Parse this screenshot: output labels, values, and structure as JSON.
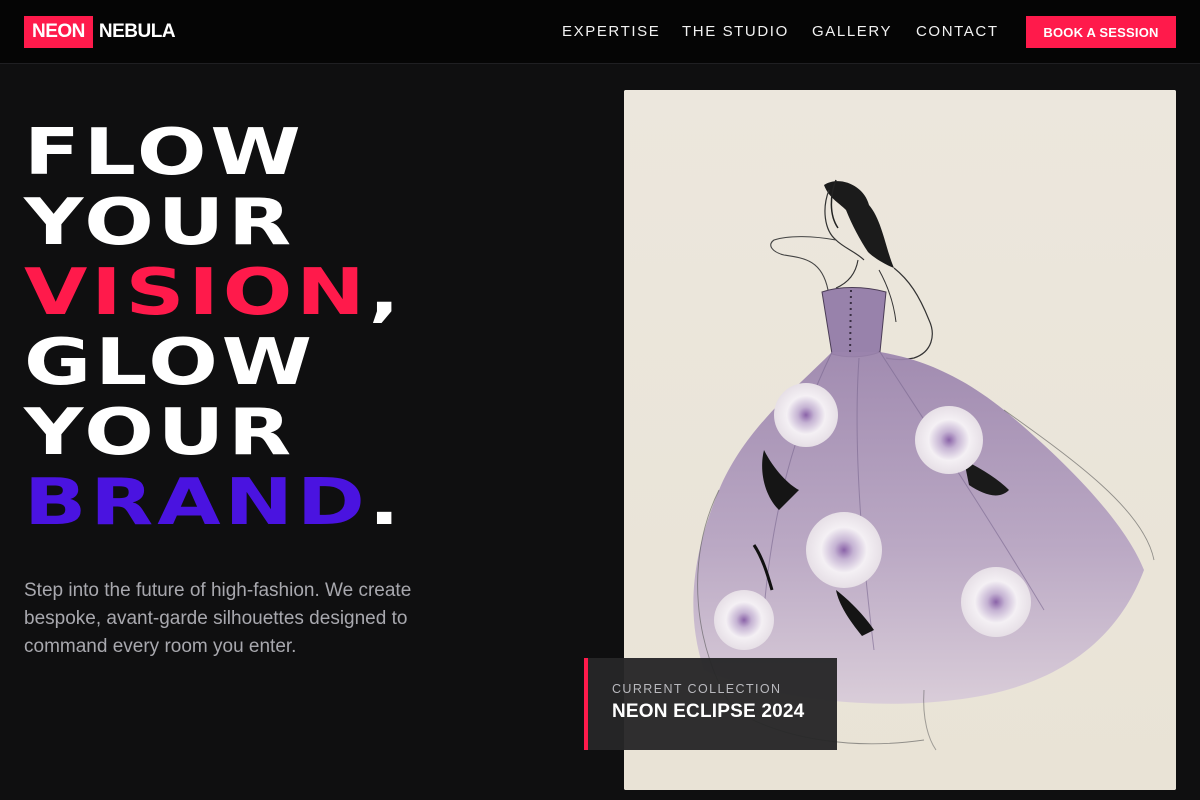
{
  "brand": {
    "part1": "NEON",
    "part2": "NEBULA"
  },
  "nav": {
    "items": [
      {
        "label": "EXPERTISE"
      },
      {
        "label": "THE STUDIO"
      },
      {
        "label": "GALLERY"
      },
      {
        "label": "CONTACT"
      }
    ],
    "cta": "BOOK A SESSION"
  },
  "hero": {
    "line1": "FLOW",
    "line2": "YOUR",
    "line3_accent": "VISION",
    "line3_punct": ",",
    "line4": "GLOW",
    "line5": "YOUR",
    "line6_accent": "BRAND",
    "line6_punct": ".",
    "subtitle": "Step into the future of high-fashion. We create bespoke, avant-garde silhouettes designed to command every room you enter."
  },
  "collection": {
    "label": "CURRENT COLLECTION",
    "name": "NEON ECLIPSE 2024"
  },
  "colors": {
    "accent_pink": "#ff1a4b",
    "accent_purple": "#4a13e0",
    "background": "#0f0f10"
  },
  "icons": {
    "hero_image": "fashion-sketch-illustration"
  }
}
